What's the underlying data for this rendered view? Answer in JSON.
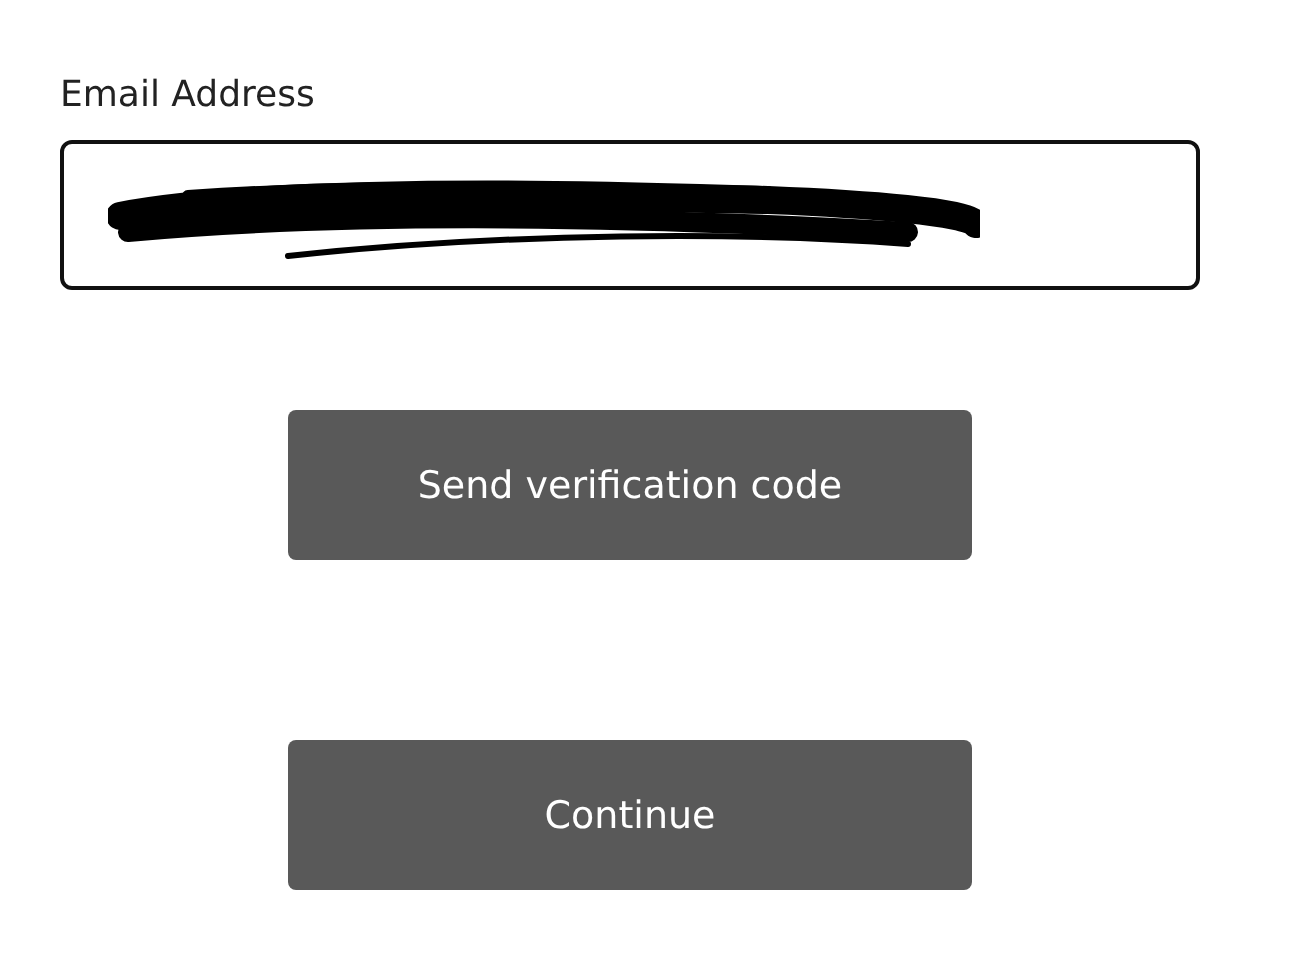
{
  "email": {
    "label": "Email Address",
    "redacted": true
  },
  "buttons": [
    "Send verification code",
    "Continue"
  ]
}
